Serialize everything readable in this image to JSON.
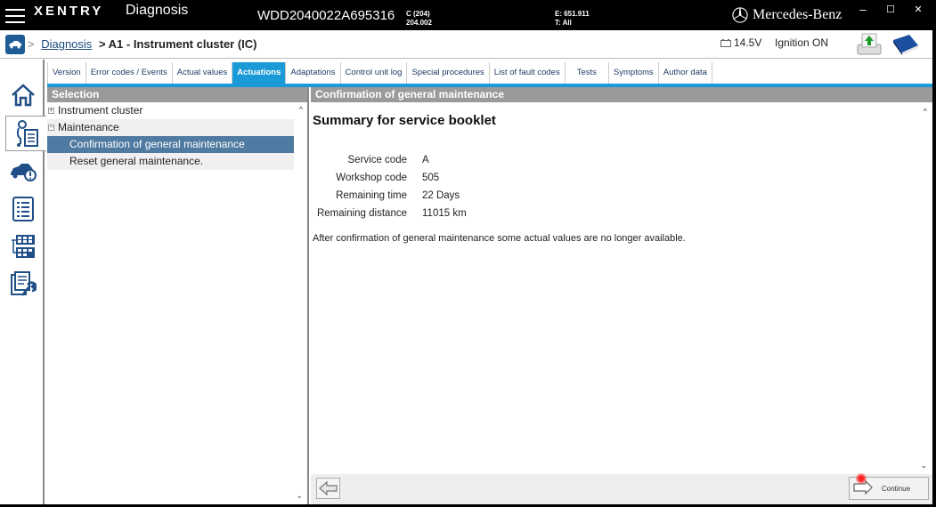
{
  "titlebar": {
    "brand": "XENTRY",
    "app_name": "Diagnosis",
    "vin": "WDD2040022A695316",
    "model_line1": "C (204)",
    "model_line2": "204.002",
    "engine_line1": "E: 651.911",
    "engine_line2": "T: All",
    "manufacturer": "Mercedes-Benz",
    "minimize": "–",
    "maximize": "☐",
    "close": "✕"
  },
  "breadcrumb": {
    "separator": ">",
    "link": "Diagnosis",
    "current": "> A1 - Instrument cluster (IC)"
  },
  "status": {
    "voltage": "14.5V",
    "ignition": "Ignition ON"
  },
  "leftnav": [
    {
      "icon": "home-icon"
    },
    {
      "icon": "diagnosis-icon",
      "active": true
    },
    {
      "icon": "vehicle-warning-icon"
    },
    {
      "icon": "list-icon"
    },
    {
      "icon": "control-units-icon"
    },
    {
      "icon": "document-tools-icon"
    }
  ],
  "tabs": [
    {
      "label": "Version"
    },
    {
      "label": "Error codes / Events"
    },
    {
      "label": "Actual values"
    },
    {
      "label": "Actuations",
      "active": true
    },
    {
      "label": "Adaptations"
    },
    {
      "label": "Control unit log"
    },
    {
      "label": "Special procedures"
    },
    {
      "label": "List of fault codes"
    },
    {
      "label": "Tests"
    },
    {
      "label": "Symptoms"
    },
    {
      "label": "Author data"
    }
  ],
  "selection": {
    "header": "Selection",
    "items": [
      {
        "label": "Instrument cluster",
        "expander": "+"
      },
      {
        "label": "Maintenance",
        "expander": "−"
      },
      {
        "label": "Confirmation of general maintenance",
        "selected": true
      },
      {
        "label": "Reset general maintenance."
      }
    ]
  },
  "content": {
    "header": "Confirmation of general maintenance",
    "title": "Summary for service booklet",
    "fields": [
      {
        "label": "Service code",
        "value": "A"
      },
      {
        "label": "Workshop code",
        "value": "505"
      },
      {
        "label": "Remaining time",
        "value": "22 Days"
      },
      {
        "label": "Remaining distance",
        "value": "11015 km"
      }
    ],
    "note": "After confirmation of general maintenance some actual values are no longer available.",
    "continue_label": "Continue"
  },
  "scroll": {
    "up": "^",
    "down": "⌄"
  }
}
